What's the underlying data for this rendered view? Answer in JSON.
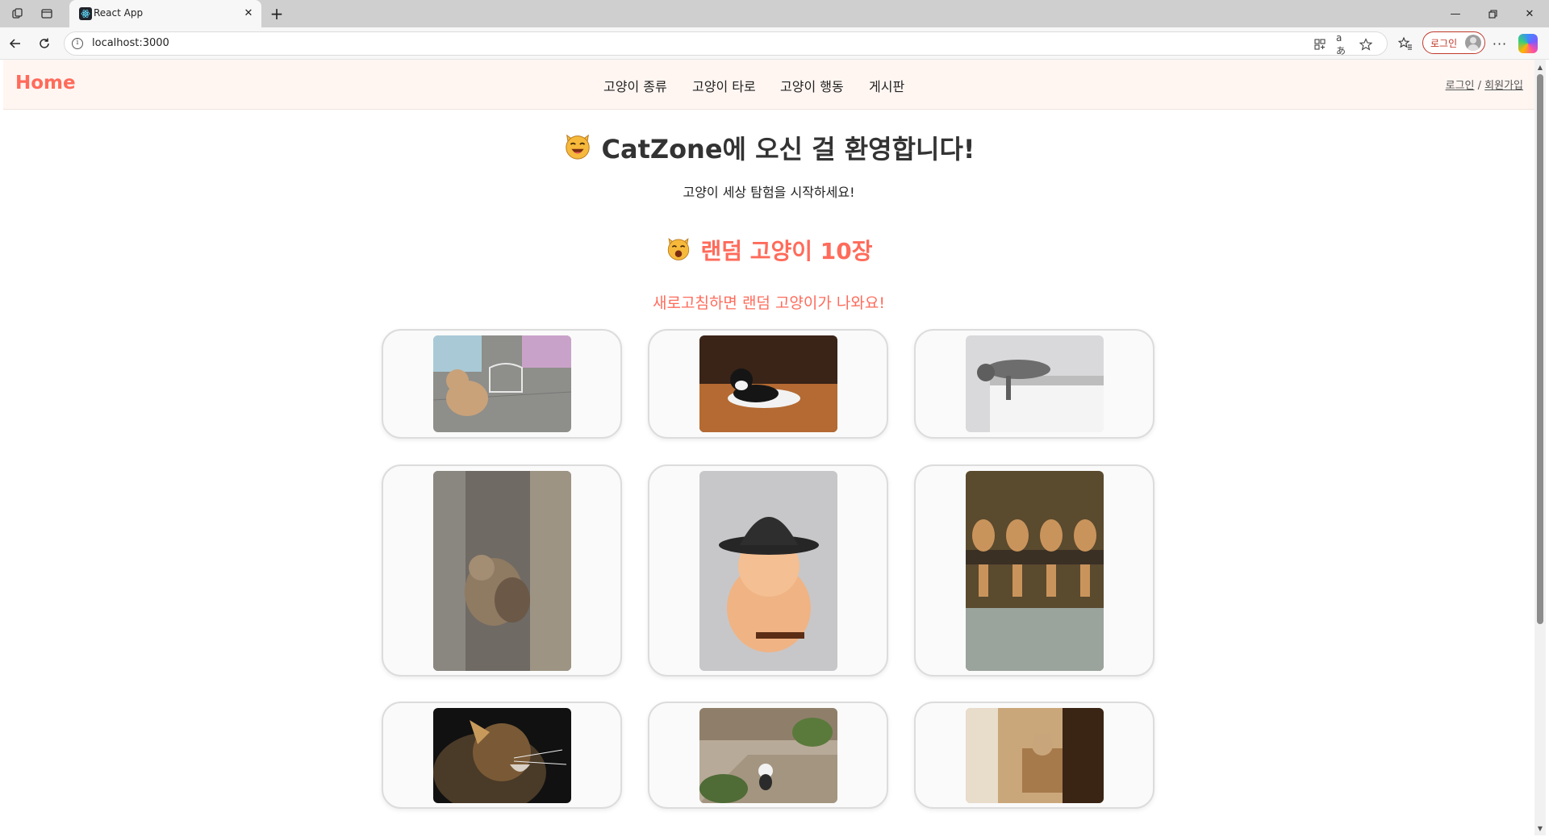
{
  "browser": {
    "tab_title": "React App",
    "url": "localhost:3000",
    "profile_label": "로그인"
  },
  "site": {
    "logo": "Home",
    "nav": [
      "고양이 종류",
      "고양이 타로",
      "고양이 행동",
      "게시판"
    ],
    "auth": {
      "login": "로그인",
      "separator": "/",
      "signup": "회원가입"
    },
    "hero_title": "CatZone에 오신 걸 환영합니다!",
    "hero_subtitle": "고양이 세상 탐험을 시작하세요!",
    "section_title": "랜덤 고양이 10장",
    "section_subtitle": "새로고침하면 랜덤 고양이가 나와요!"
  },
  "colors": {
    "accent": "#ff6b5b",
    "header_bg": "#fff6f2",
    "card_bg": "#fafafa",
    "card_border": "#dcdcdc"
  },
  "cats": [
    {
      "alt": "cat-photo-1"
    },
    {
      "alt": "cat-photo-2"
    },
    {
      "alt": "cat-photo-3"
    },
    {
      "alt": "cat-photo-4"
    },
    {
      "alt": "cat-photo-5"
    },
    {
      "alt": "cat-photo-6"
    },
    {
      "alt": "cat-photo-7"
    },
    {
      "alt": "cat-photo-8"
    },
    {
      "alt": "cat-photo-9"
    }
  ]
}
